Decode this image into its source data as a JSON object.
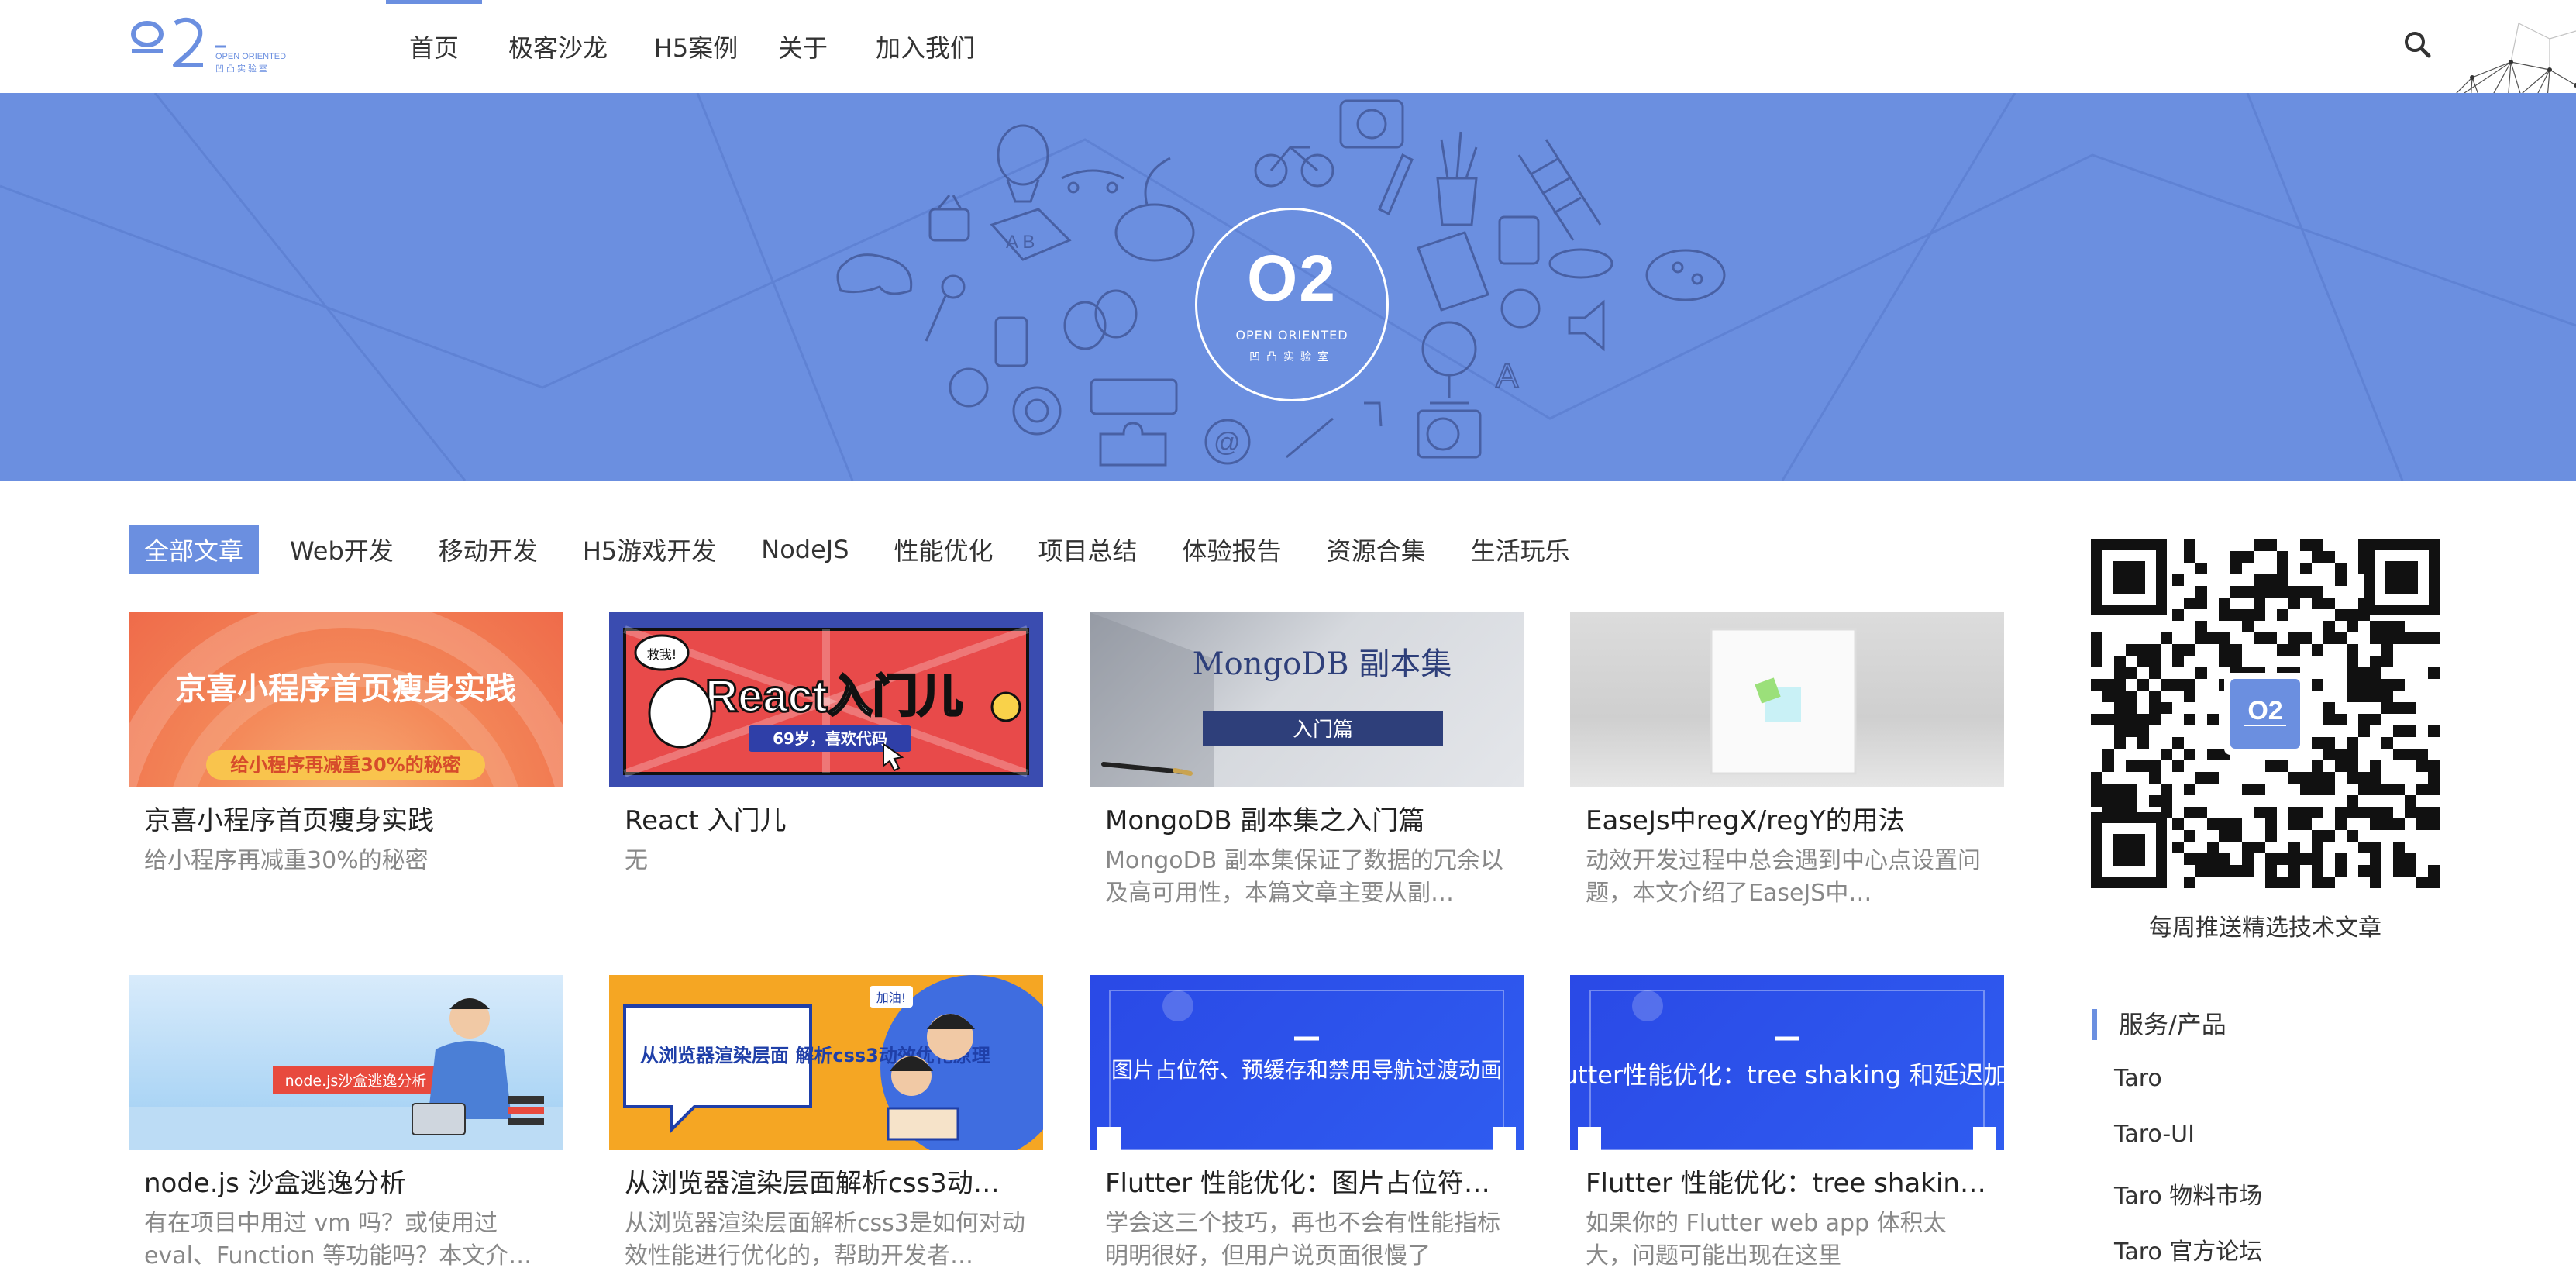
{
  "header": {
    "logo_text": "O2",
    "logo_sub_en": "OPEN ORIENTED",
    "logo_sub_cn": "凹凸实验室",
    "nav": [
      {
        "label": "首页",
        "active": true
      },
      {
        "label": "极客沙龙",
        "active": false
      },
      {
        "label": "H5案例",
        "active": false
      },
      {
        "label": "关于",
        "active": false
      },
      {
        "label": "加入我们",
        "active": false
      }
    ],
    "search_icon": "search-icon",
    "accent_color": "#6b8fe0"
  },
  "banner": {
    "badge_logo": "O2",
    "badge_en": "OPEN ORIENTED",
    "badge_cn": "凹凸实验室",
    "background": "#6b8fe0"
  },
  "categories": [
    "全部文章",
    "Web开发",
    "移动开发",
    "H5游戏开发",
    "NodeJS",
    "性能优化",
    "项目总结",
    "体验报告",
    "资源合集",
    "生活玩乐"
  ],
  "articles": [
    {
      "title": "京喜小程序首页瘦身实践",
      "desc": "给小程序再减重30%的秘密",
      "thumb_title": "京喜小程序首页瘦身实践",
      "thumb_sub": "给小程序再减重30%的秘密"
    },
    {
      "title": "React 入门儿",
      "desc": "无",
      "thumb_title": "React入门儿",
      "thumb_sub": "69岁，喜欢代码",
      "thumb_tag": "救我!"
    },
    {
      "title": "MongoDB 副本集之入门篇",
      "desc": "MongoDB 副本集保证了数据的冗余以及高可用性，本篇文章主要从副…",
      "thumb_title": "MongoDB 副本集",
      "thumb_sub": "入门篇"
    },
    {
      "title": "EaseJs中regX/regY的用法",
      "desc": "动效开发过程中总会遇到中心点设置问题，本文介绍了EaseJS中…"
    },
    {
      "title": "node.js 沙盒逃逸分析",
      "desc": "有在项目中用过 vm 吗？或使用过 eval、Function 等功能吗？本文介…",
      "thumb_tag": "node.js沙盒逃逸分析"
    },
    {
      "title": "从浏览器渲染层面解析css3动…",
      "desc": "从浏览器渲染层面解析css3是如何对动效性能进行优化的，帮助开发者…",
      "thumb_title": "从浏览器渲染层面 解析css3动效优化原理",
      "thumb_tag": "加油!"
    },
    {
      "title": "Flutter 性能优化：图片占位符…",
      "desc": "学会这三个技巧，再也不会有性能指标明明很好，但用户说页面很慢了",
      "thumb_title": "图片占位符、预缓存和禁用导航过渡动画"
    },
    {
      "title": "Flutter 性能优化：tree shakin…",
      "desc": "如果你的 Flutter web app 体积太大，问题可能出现在这里",
      "thumb_title": "Flutter性能优化：tree shaking 和延迟加载"
    }
  ],
  "sidebar": {
    "qr_caption": "每周推送精选技术文章",
    "section_title": "服务/产品",
    "links": [
      "Taro",
      "Taro-UI",
      "Taro 物料市场",
      "Taro 官方论坛"
    ]
  }
}
